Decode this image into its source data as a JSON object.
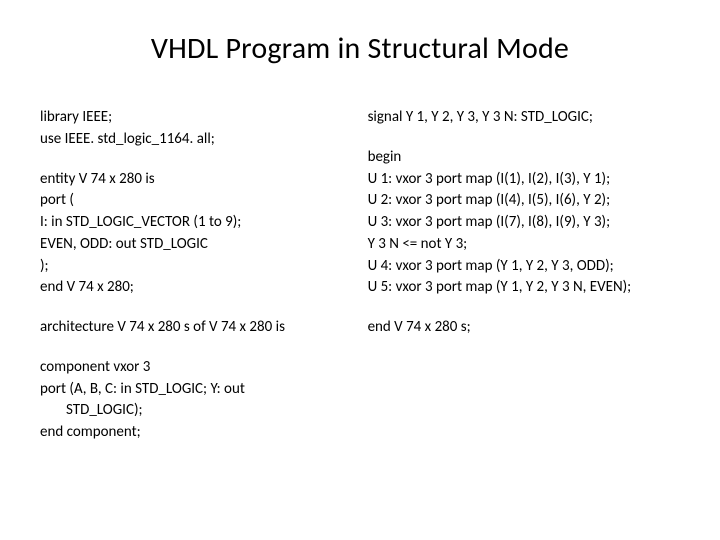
{
  "title": "VHDL Program in Structural Mode",
  "left": {
    "l1": "library IEEE;",
    "l2": "use IEEE. std_logic_1164. all;",
    "l3": "entity V 74 x 280 is",
    "l4": "port (",
    "l5": "I: in STD_LOGIC_VECTOR (1 to 9);",
    "l6": "EVEN, ODD: out STD_LOGIC",
    "l7": ");",
    "l8": "end V 74 x 280;",
    "l9": "architecture V 74 x 280 s of V 74 x 280 is",
    "l10": "component vxor 3",
    "l11": "port (A, B, C: in STD_LOGIC; Y: out",
    "l11b": "STD_LOGIC);",
    "l12": "end component;"
  },
  "right": {
    "r1": "signal Y 1, Y 2, Y 3, Y 3 N: STD_LOGIC;",
    "r2": "begin",
    "r3": "U 1: vxor 3 port map (I(1), I(2), I(3), Y 1);",
    "r4": "U 2: vxor 3 port map (I(4), I(5), I(6), Y 2);",
    "r5": "U 3: vxor 3 port map (I(7), I(8), I(9), Y 3);",
    "r6": "Y 3 N <= not Y 3;",
    "r7": "U 4: vxor 3 port map (Y 1, Y 2, Y 3, ODD);",
    "r8": "U 5: vxor 3 port map (Y 1, Y 2, Y 3 N, EVEN);",
    "r9": "end V 74 x 280 s;"
  }
}
